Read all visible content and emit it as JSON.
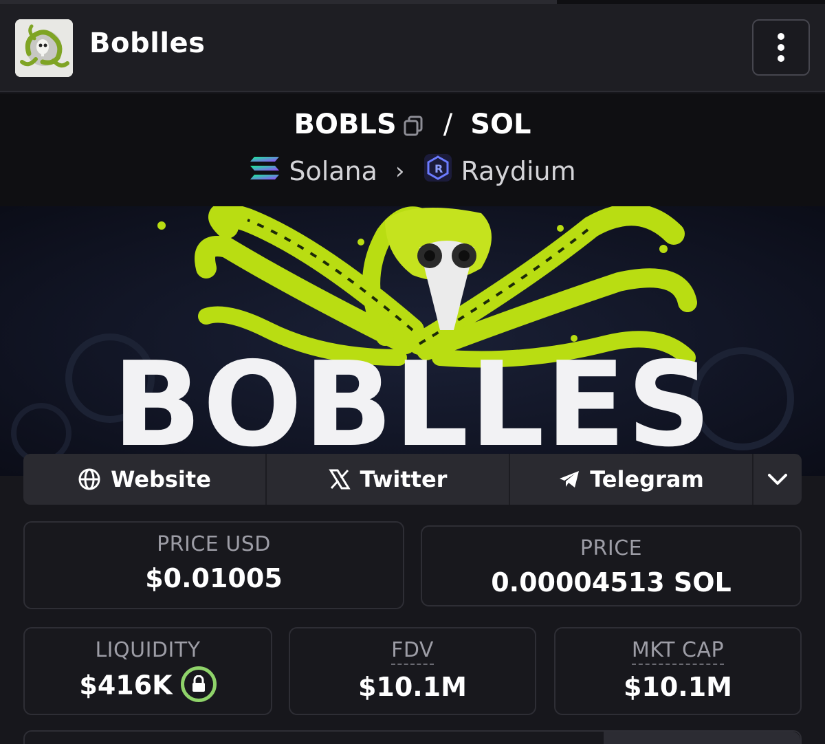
{
  "header": {
    "title": "Boblles",
    "logo_icon": "octopus-logo-icon",
    "menu_icon": "kebab-menu-icon"
  },
  "pair": {
    "base": "BOBLS",
    "separator": "/",
    "quote": "SOL",
    "chain": "Solana",
    "dex": "Raydium"
  },
  "banner": {
    "word": "BOBLLES",
    "accent_color": "#c7e81a"
  },
  "links": [
    {
      "label": "Website",
      "icon": "globe-icon"
    },
    {
      "label": "Twitter",
      "icon": "x-icon"
    },
    {
      "label": "Telegram",
      "icon": "telegram-icon"
    }
  ],
  "stats": {
    "price_usd": {
      "label": "PRICE USD",
      "value": "$0.01005"
    },
    "price": {
      "label": "PRICE",
      "value": "0.00004513 SOL"
    },
    "liquidity": {
      "label": "LIQUIDITY",
      "value": "$416K"
    },
    "fdv": {
      "label": "FDV",
      "value": "$10.1M"
    },
    "mkt_cap": {
      "label": "MKT CAP",
      "value": "$10.1M"
    }
  }
}
